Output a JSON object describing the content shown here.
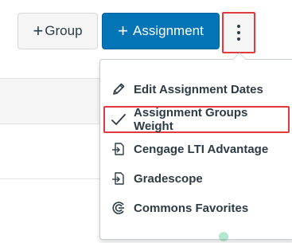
{
  "toolbar": {
    "group_button": {
      "plus": "+",
      "label": "Group"
    },
    "assignment_button": {
      "plus": "+",
      "label": "Assignment"
    },
    "more_button_icon": "kebab-vertical-icon"
  },
  "menu": {
    "items": [
      {
        "label": "Edit Assignment Dates",
        "icon": "pencil-icon"
      },
      {
        "label": "Assignment Groups Weight",
        "icon": "checkmark-icon",
        "selected": true
      },
      {
        "label": "Cengage LTI Advantage",
        "icon": "external-tool-icon"
      },
      {
        "label": "Gradescope",
        "icon": "external-tool-icon"
      },
      {
        "label": "Commons Favorites",
        "icon": "commons-icon"
      }
    ]
  },
  "colors": {
    "primary": "#0374b5",
    "highlight": "#e0393e",
    "text": "#2d3b45"
  }
}
